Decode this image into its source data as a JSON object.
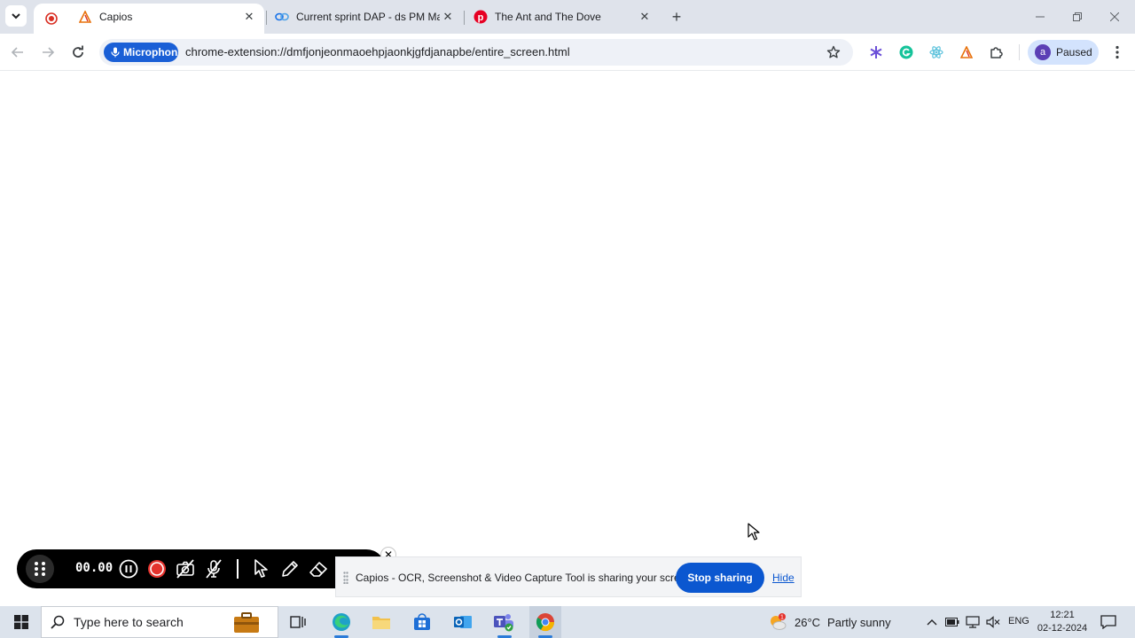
{
  "browser": {
    "tabs": [
      {
        "title": "",
        "icon": "record-icon",
        "active": true
      },
      {
        "title": "Capios",
        "icon": "capios-icon",
        "active": false
      },
      {
        "title": "Current sprint DAP - ds PM Ma",
        "icon": "link-icon",
        "active": false
      },
      {
        "title": "The Ant and The Dove",
        "icon": "pinterest-icon",
        "active": false
      }
    ],
    "close_glyph": "✕",
    "new_tab_glyph": "+",
    "mic_chip_label": "Microphone",
    "url": "chrome-extension://dmfjonjeonmaoehpjaonkjgfdjanapbe/entire_screen.html",
    "profile_initial": "a",
    "profile_status": "Paused"
  },
  "capture_toolbar": {
    "timer": "00.00",
    "close_glyph": "✕"
  },
  "share_bar": {
    "message": "Capios - OCR, Screenshot & Video Capture Tool is sharing your screen.",
    "stop_label": "Stop sharing",
    "hide_label": "Hide"
  },
  "taskbar": {
    "search_placeholder": "Type here to search",
    "weather_temp": "26°C",
    "weather_desc": "Partly sunny",
    "weather_badge": "1",
    "language": "ENG",
    "time": "12:21",
    "date": "02-12-2024"
  },
  "colors": {
    "accent_blue": "#0b57d0",
    "record_red": "#d93025",
    "tabstrip_bg": "#dfe3eb"
  }
}
